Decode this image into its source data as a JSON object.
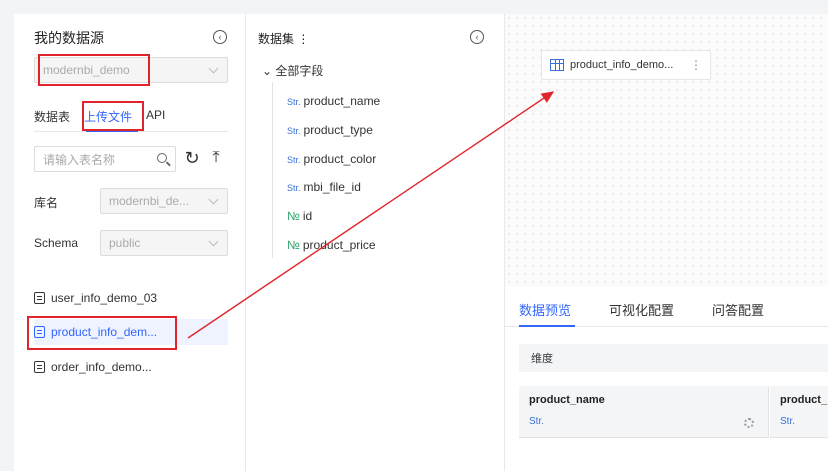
{
  "sources": {
    "title": "我的数据源",
    "selected_source": "modernbi_demo",
    "tabs": [
      "数据表",
      "上传文件",
      "API"
    ],
    "active_tab": "上传文件",
    "search_placeholder": "请输入表名称",
    "db_label": "库名",
    "db_value": "modernbi_de...",
    "schema_label": "Schema",
    "schema_value": "public",
    "files": [
      "user_info_demo_03",
      "product_info_dem...",
      "order_info_demo..."
    ],
    "selected_file": "product_info_dem..."
  },
  "dataset": {
    "title": "数据集",
    "root_label": "全部字段",
    "fields": [
      {
        "type": "Str.",
        "name": "product_name"
      },
      {
        "type": "Str.",
        "name": "product_type"
      },
      {
        "type": "Str.",
        "name": "product_color"
      },
      {
        "type": "Str.",
        "name": "mbi_file_id"
      },
      {
        "type": "№",
        "name": "id"
      },
      {
        "type": "№",
        "name": "product_price"
      }
    ]
  },
  "canvas": {
    "node_label": "product_info_demo...",
    "node_menu": "⋮"
  },
  "preview": {
    "tabs": [
      "数据预览",
      "可视化配置",
      "问答配置"
    ],
    "active_tab": "数据预览",
    "dimension_label": "维度",
    "columns": [
      {
        "name": "product_name",
        "type": "Str."
      },
      {
        "name": "product_",
        "type": "Str."
      }
    ]
  },
  "colors": {
    "accent": "#3366ff",
    "highlight": "#e0242c"
  }
}
